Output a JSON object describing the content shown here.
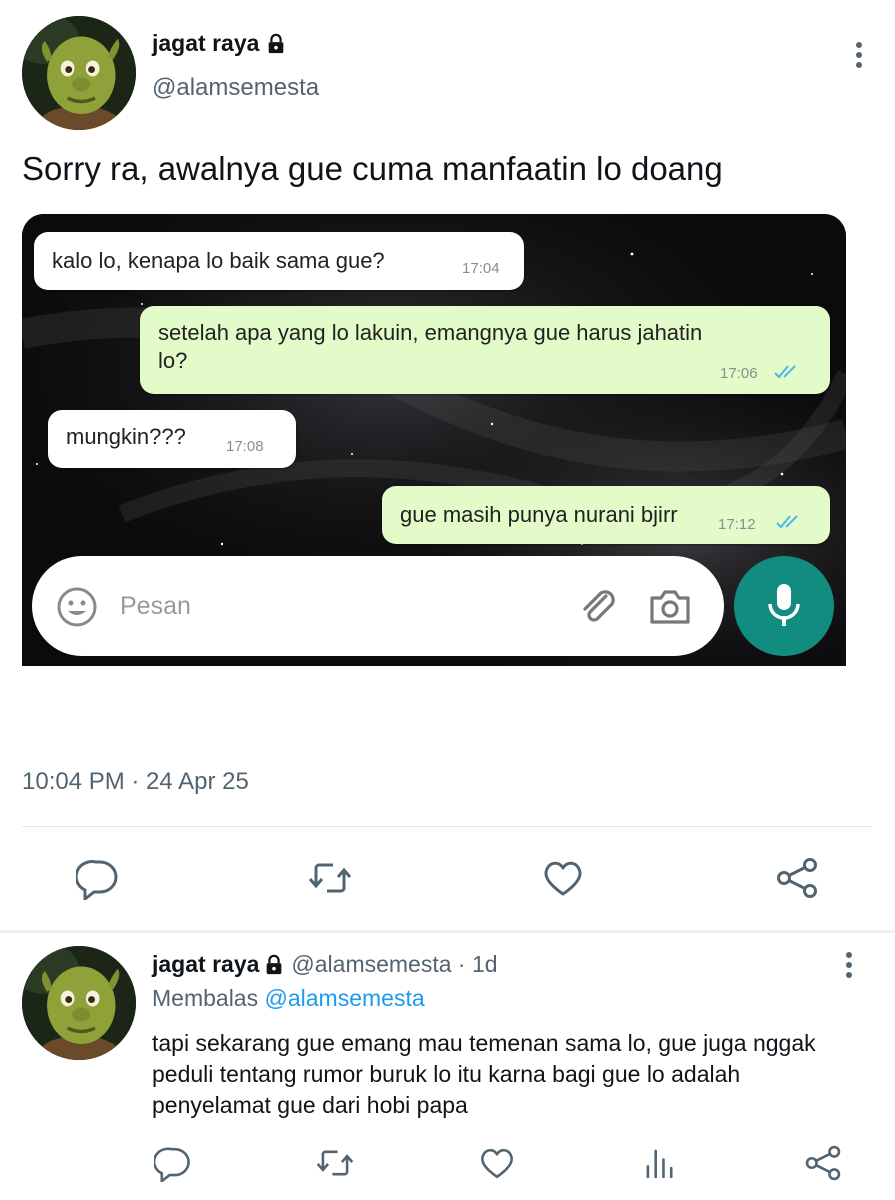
{
  "tweet": {
    "display_name": "jagat raya",
    "handle": "@alamsemesta",
    "text": "Sorry ra, awalnya gue cuma manfaatin lo doang",
    "timestamp": "10:04 PM · 24 Apr 25",
    "icons": {
      "lock": "lock-icon",
      "more": "more-vertical-icon",
      "reply": "reply-icon",
      "retweet": "retweet-icon",
      "like": "like-icon",
      "share": "share-icon"
    }
  },
  "chat": {
    "messages": [
      {
        "direction": "incoming",
        "text": "kalo lo, kenapa lo baik sama gue?",
        "time": "17:04"
      },
      {
        "direction": "outgoing",
        "text_line1": "setelah apa yang lo lakuin, emangnya gue harus jahatin",
        "text_line2": "lo?",
        "time": "17:06",
        "status": "read"
      },
      {
        "direction": "incoming",
        "text": "mungkin???",
        "time": "17:08"
      },
      {
        "direction": "outgoing",
        "text": "gue masih punya nurani bjirr",
        "time": "17:12",
        "status": "read"
      }
    ],
    "input_placeholder": "Pesan",
    "colors": {
      "outgoing_bubble": "#e2fbc9",
      "incoming_bubble": "#ffffff",
      "mic_button": "#128c7e",
      "read_ticks": "#4fb6ec"
    },
    "icons": {
      "emoji": "emoji-icon",
      "attach": "paperclip-icon",
      "camera": "camera-icon",
      "mic": "microphone-icon"
    }
  },
  "reply": {
    "display_name": "jagat raya",
    "handle_time": "@alamsemesta · 1d",
    "replying_prefix": "Membalas",
    "replying_to": "@alamsemesta",
    "text": "tapi sekarang gue emang mau temenan sama lo, gue juga nggak peduli tentang rumor buruk lo itu karna bagi gue lo adalah penyelamat gue dari hobi papa",
    "icons": {
      "reply": "reply-icon",
      "retweet": "retweet-icon",
      "like": "like-icon",
      "views": "views-icon",
      "share": "share-icon"
    }
  },
  "colors": {
    "text": "#0f1419",
    "secondary": "#536471",
    "link": "#1d9bf0"
  }
}
